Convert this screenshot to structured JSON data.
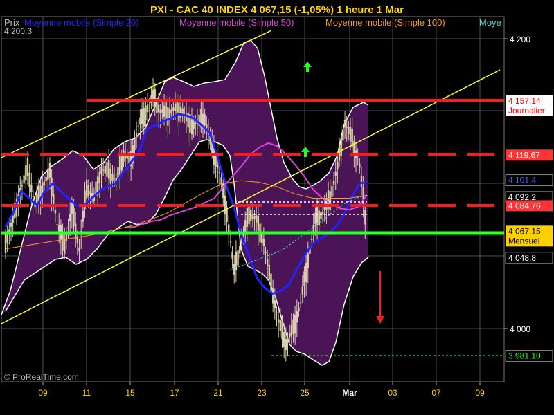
{
  "header": {
    "title": "PXI - CAC 40 INDEX     4 067,15 (-1,05%)     1 heure  1 Mar"
  },
  "legend": {
    "prix": "Prix",
    "items": [
      {
        "label": "Moyenne mobile (Simple 20)",
        "color": "#2222ff"
      },
      {
        "label": "Moyenne mobile (Simple 50)",
        "color": "#e040e0"
      },
      {
        "label": "Moyenne mobile (Simple 100)",
        "color": "#ff9a1a"
      },
      {
        "label": "Moye",
        "color": "#40e0c8"
      }
    ],
    "high_label": "4 200,3"
  },
  "watermark": "© ProRealTime.com",
  "colors": {
    "background": "#000000",
    "band_fill": "#4a1456",
    "candle": "#d8d0a8",
    "title": "#ffd200",
    "resistance": "#ff1a1a",
    "support": "#33ff33",
    "channel": "#ffff33",
    "grid": "#555555"
  },
  "chart_data": {
    "type": "line",
    "title": "PXI - CAC 40 INDEX     4 067,15 (-1,05%)     1 heure  1 Mar",
    "xlabel": "",
    "ylabel": "",
    "ylim": [
      3970,
      4207
    ],
    "grid": true,
    "x_ticks": [
      "09",
      "11",
      "15",
      "17",
      "21",
      "23",
      "25",
      "Mar",
      "03",
      "07",
      "09"
    ],
    "y_ticks": [
      {
        "value": 4200,
        "label": "4 200"
      },
      {
        "value": 4000,
        "label": "4 000"
      }
    ],
    "price_labels": [
      {
        "value": 4157.14,
        "label": "4 157,14",
        "sub": "Journalier",
        "bg": "#ffffff",
        "fg": "#ff0000"
      },
      {
        "value": 4119.67,
        "label": "4 119,67",
        "bg": "#ff3333",
        "fg": "#ffffff"
      },
      {
        "value": 4101.4,
        "label": "4 101,4",
        "bg": "#000000",
        "fg": "#4466ff"
      },
      {
        "value": 4092.2,
        "label": "4 092,2",
        "bg": "#000000",
        "fg": "#ffffff"
      },
      {
        "value": 4084.76,
        "label": "4 084,76",
        "bg": "#ff3333",
        "fg": "#ffffff"
      },
      {
        "value": 4067.15,
        "label": "4 067,15",
        "sub": "Mensuel",
        "bg": "#ffd000",
        "fg": "#000000"
      },
      {
        "value": 4048.8,
        "label": "4 048,8",
        "bg": "#000000",
        "fg": "#ffffff"
      },
      {
        "value": 3981.1,
        "label": "3 981,10",
        "bg": "#000000",
        "fg": "#33ff33"
      }
    ],
    "levels": {
      "journalier": 4157.14,
      "hebdo_resistance": 4119.67,
      "hebdo_support": 4084.76,
      "mensuel": 4067.15,
      "bas": 3981.1
    },
    "series": [
      {
        "name": "Prix",
        "values": [
          4060,
          4075,
          4095,
          4110,
          4085,
          4098,
          4108,
          4072,
          4058,
          4082,
          4055,
          4098,
          4090,
          4110,
          4108,
          4102,
          4120,
          4116,
          4140,
          4150,
          4160,
          4150,
          4148,
          4152,
          4150,
          4140,
          4142,
          4145,
          4125,
          4108,
          4080,
          4040,
          4060,
          4080,
          4075,
          4060,
          4030,
          4005,
          3990,
          4000,
          4018,
          4048,
          4075,
          4080,
          4090,
          4112,
          4142,
          4130,
          4112,
          4067
        ]
      },
      {
        "name": "Moyenne mobile (Simple 20)",
        "values": [
          4070,
          4080,
          4095,
          4090,
          4085,
          4095,
          4100,
          4095,
          4090,
          4085,
          4085,
          4090,
          4095,
          4098,
          4100,
          4108,
          4115,
          4122,
          4138,
          4140,
          4143,
          4145,
          4148,
          4147,
          4145,
          4140,
          4135,
          4118,
          4100,
          4085,
          4065,
          4050,
          4035,
          4028,
          4024,
          4026,
          4030,
          4040,
          4050,
          4058,
          4062,
          4065,
          4070,
          4078,
          4090,
          4100,
          4101.4
        ]
      },
      {
        "name": "Moyenne mobile (Simple 50)",
        "values": [
          4070,
          4070,
          4072,
          4074,
          4075,
          4078,
          4080,
          4082,
          4084,
          4087,
          4090,
          4098,
          4105,
          4112,
          4120,
          4125,
          4128,
          4126,
          4120,
          4113,
          4105,
          4096,
          4090,
          4086,
          4083,
          4082,
          4084,
          4092.2
        ]
      },
      {
        "name": "Moyenne mobile (Simple 100)",
        "values": [
          4055,
          4057,
          4059,
          4061,
          4063,
          4065,
          4068,
          4071,
          4075,
          4080,
          4087,
          4094,
          4100,
          4102,
          4101,
          4098,
          4093,
          4090,
          4090,
          4090,
          4092
        ]
      },
      {
        "name": "Moye",
        "values": [
          4040,
          4043,
          4046,
          4049,
          4052,
          4056,
          4062,
          4068,
          4074,
          4080,
          4086,
          4090,
          4092
        ]
      }
    ]
  }
}
